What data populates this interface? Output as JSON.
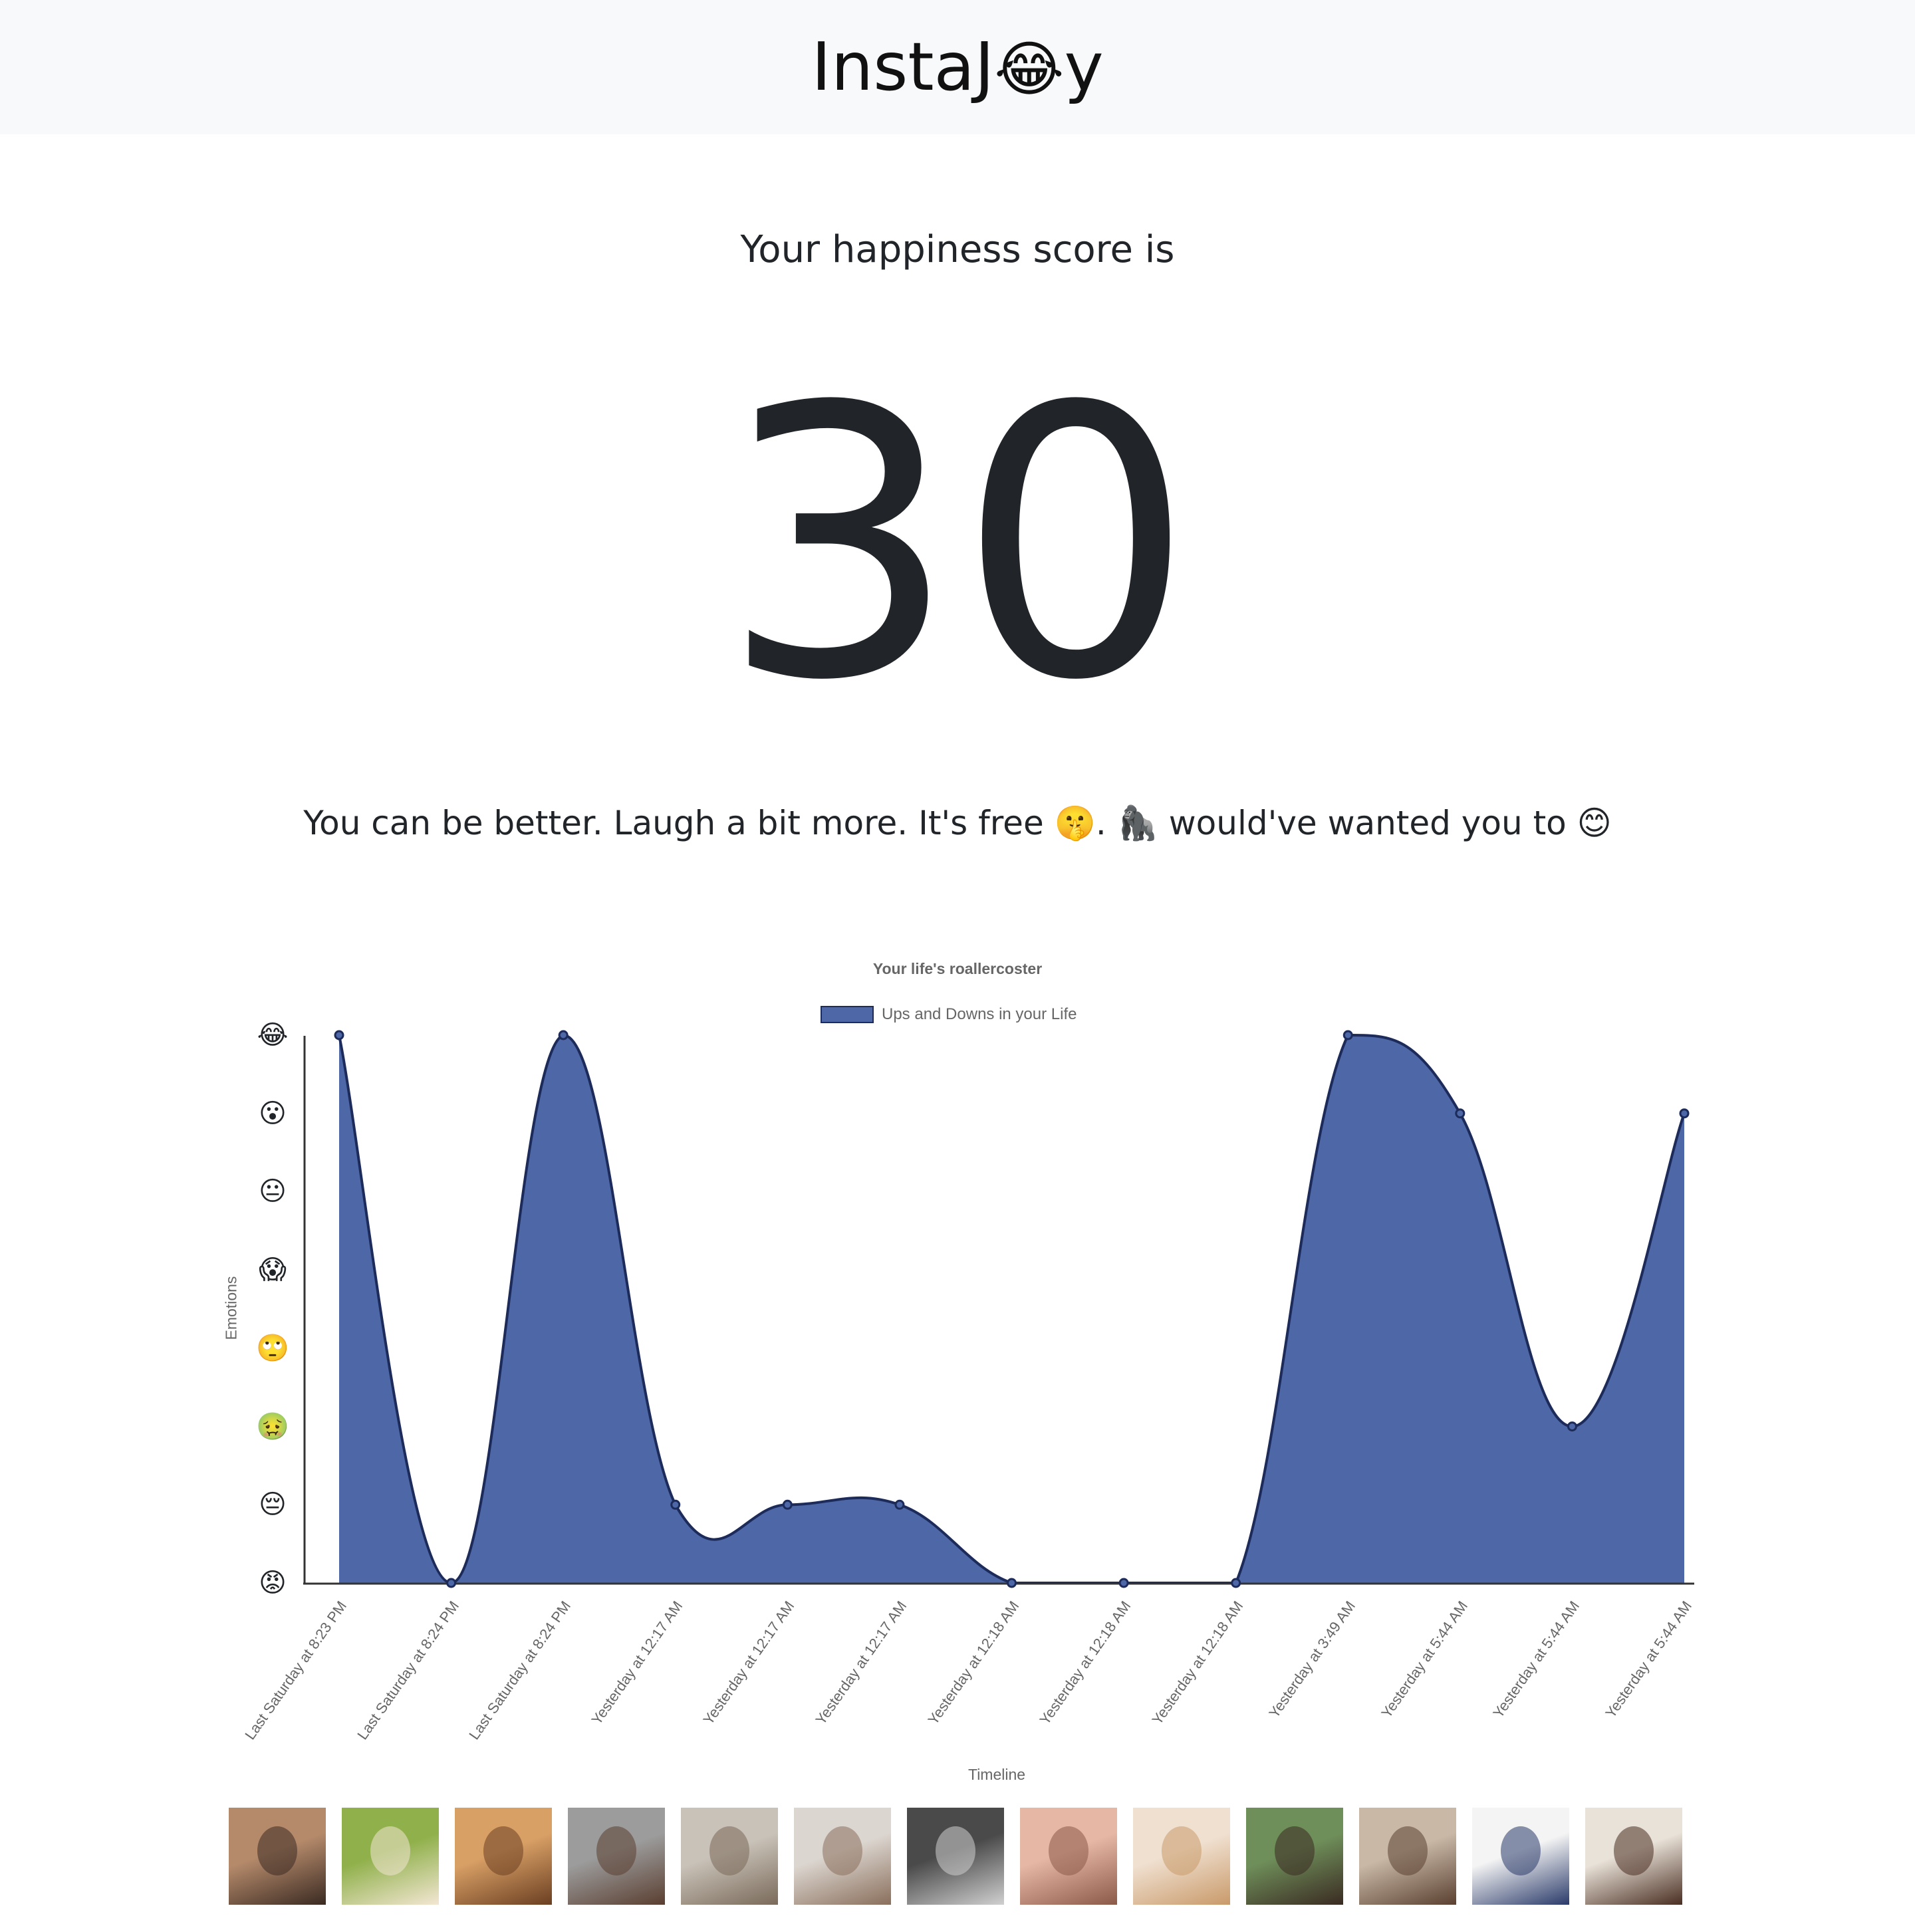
{
  "navbar": {
    "brand_prefix": "InstaJ",
    "brand_emoji": "😂",
    "brand_suffix": "y"
  },
  "score": {
    "intro": "Your happiness score is",
    "value": "30",
    "message": "You can be better. Laugh a bit more. It's free 🤫. 🦍 would've wanted you to 😊"
  },
  "chart_data": {
    "type": "area",
    "title": "Your life's roallercoster",
    "legend_position": "top",
    "xlabel": "Timeline",
    "ylabel": "Emotions",
    "y_tick_labels": [
      "😡",
      "😔",
      "🤢",
      "🙄",
      "😱",
      "😐",
      "😮",
      "😂"
    ],
    "ylim": [
      0,
      7
    ],
    "grid": false,
    "categories": [
      "Last Saturday at 8:23 PM",
      "Last Saturday at 8:24 PM",
      "Last Saturday at 8:24 PM",
      "Yesterday at 12:17 AM",
      "Yesterday at 12:17 AM",
      "Yesterday at 12:17 AM",
      "Yesterday at 12:18 AM",
      "Yesterday at 12:18 AM",
      "Yesterday at 12:18 AM",
      "Yesterday at 3:49 AM",
      "Yesterday at 5:44 AM",
      "Yesterday at 5:44 AM",
      "Yesterday at 5:44 AM"
    ],
    "series": [
      {
        "name": "Ups and Downs in your Life",
        "values": [
          7,
          0,
          7,
          1,
          1,
          1,
          0,
          0,
          0,
          7,
          6,
          2,
          6
        ],
        "fill_color": "#4d67a7",
        "line_color": "#1c2b5a"
      }
    ]
  },
  "photos": [
    {
      "label": "group-of-friends-photo",
      "colors": [
        "#b58a6b",
        "#3a2a22"
      ]
    },
    {
      "label": "laughing-child-photo",
      "colors": [
        "#8fb04a",
        "#f3e6d3"
      ]
    },
    {
      "label": "smiling-woman-photo",
      "colors": [
        "#d9a066",
        "#6b3f22"
      ]
    },
    {
      "label": "crying-boy-photo",
      "colors": [
        "#9c9c9c",
        "#5a3e30"
      ]
    },
    {
      "label": "stressed-woman-photo",
      "colors": [
        "#c9c2b8",
        "#7a6a5a"
      ]
    },
    {
      "label": "tired-woman-photo",
      "colors": [
        "#dcd6d0",
        "#8a6f5c"
      ]
    },
    {
      "label": "angry-man-bw-photo",
      "colors": [
        "#4a4a4a",
        "#d0d0d0"
      ]
    },
    {
      "label": "angry-baby-photo",
      "colors": [
        "#e7b7a5",
        "#8c5a48"
      ]
    },
    {
      "label": "annoyed-woman-photo",
      "colors": [
        "#f0e0d0",
        "#c99a6a"
      ]
    },
    {
      "label": "elderly-couple-photo",
      "colors": [
        "#6f8f5a",
        "#3a2a22"
      ]
    },
    {
      "label": "father-and-child-photo",
      "colors": [
        "#c9b8a6",
        "#5a4030"
      ]
    },
    {
      "label": "disgusted-woman-photo",
      "colors": [
        "#f4f4f4",
        "#2a3a6a"
      ]
    },
    {
      "label": "surprised-boy-photo",
      "colors": [
        "#e9e2d8",
        "#4a2e22"
      ]
    }
  ]
}
